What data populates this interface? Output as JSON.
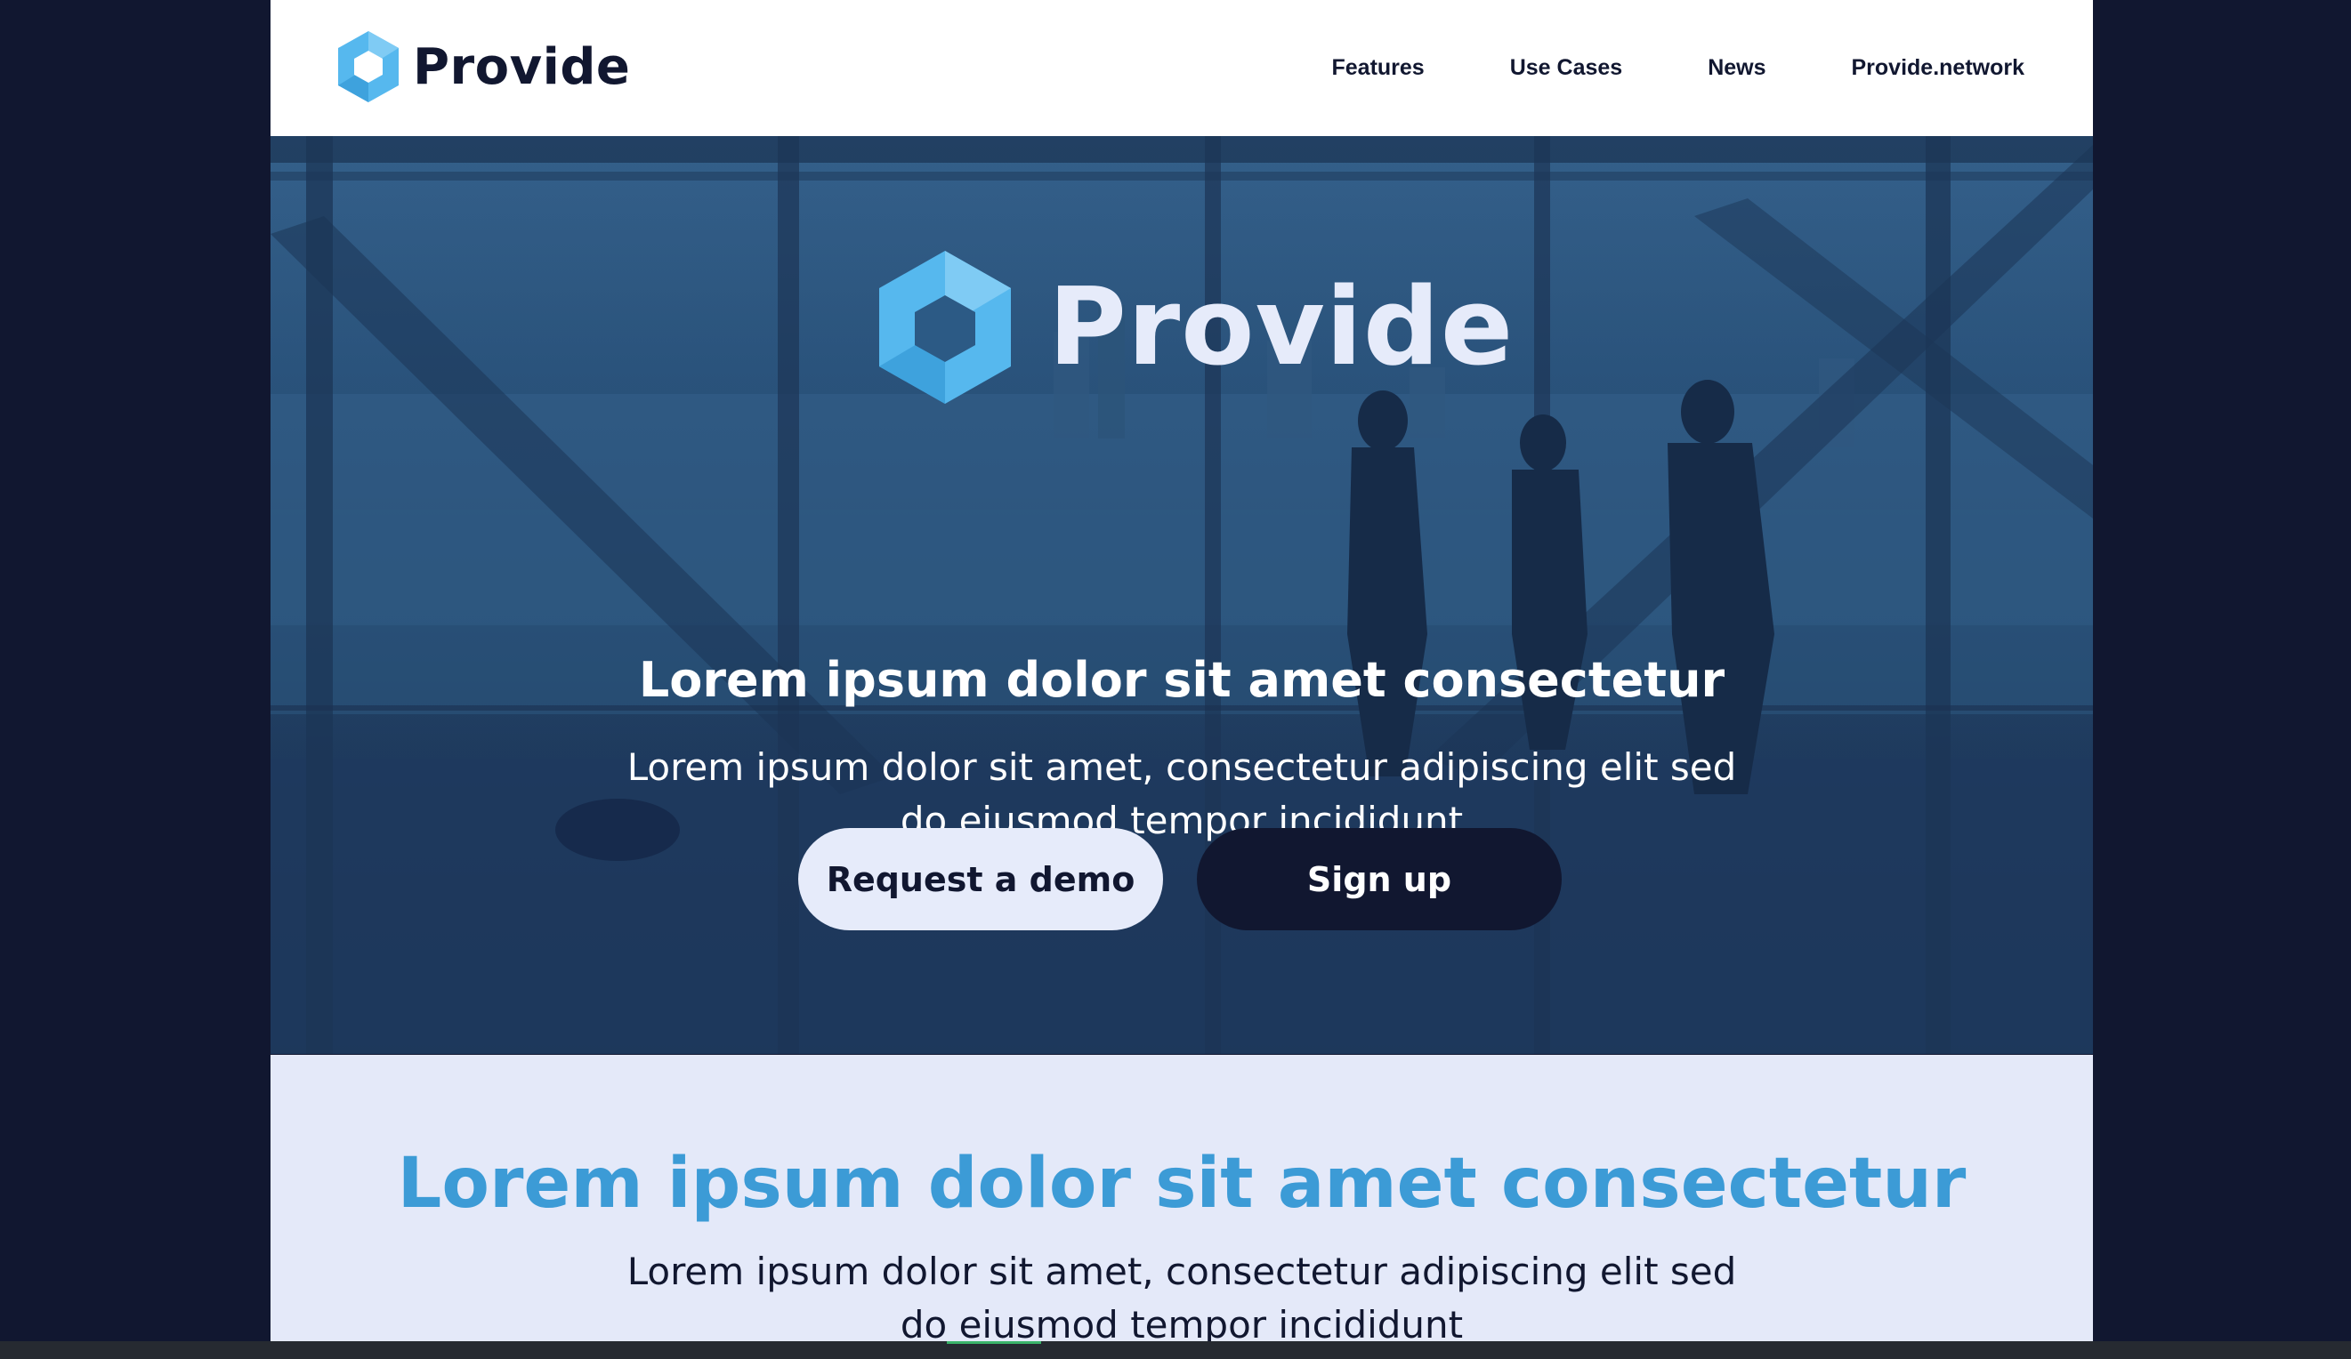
{
  "brand": {
    "name": "Provide",
    "logo_icon": "hexagon-logo-icon",
    "accent_color": "#3c9bd6",
    "dark_color": "#111730",
    "light_color": "#e6ebfa"
  },
  "nav": {
    "items": [
      {
        "label": "Features"
      },
      {
        "label": "Use Cases"
      },
      {
        "label": "News"
      },
      {
        "label": "Provide.network"
      }
    ]
  },
  "hero": {
    "logo_text": "Provide",
    "headline": "Lorem ipsum dolor sit amet consectetur",
    "subtext_line1": "Lorem ipsum dolor sit amet, consectetur adipiscing elit sed",
    "subtext_line2": "do eiusmod tempor incididunt",
    "buttons": {
      "demo_label": "Request a demo",
      "signup_label": "Sign up"
    }
  },
  "section": {
    "title": "Lorem ipsum dolor sit amet consectetur",
    "subtext_line1": "Lorem ipsum dolor sit amet, consectetur adipiscing elit sed",
    "subtext_line2": "do eiusmod tempor incididunt"
  }
}
